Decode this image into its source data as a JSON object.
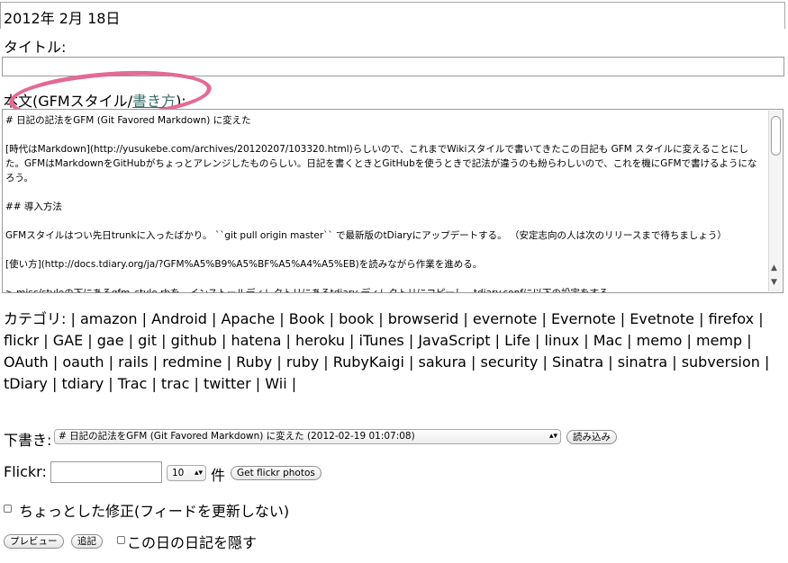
{
  "date": "2012年 2月 18日",
  "title_label": "タイトル:",
  "title_value": "",
  "body_label": {
    "prefix": "本文(GFMスタイル/",
    "link": "書き方",
    "suffix": "):"
  },
  "body_lines": [
    "# 日記の記法をGFM (Git Favored Markdown) に変えた",
    "[時代はMarkdown](http://yusukebe.com/archives/20120207/103320.html)らしいので、これまでWikiスタイルで書いてきたこの日記も GFM スタイルに変えることにした。GFMはMarkdownをGitHubがちょっとアレンジしたものらしい。日記を書くときとGitHubを使うときで記法が違うのも紛らわしいので、これを機にGFMで書けるようになろう。",
    "## 導入方法",
    "GFMスタイルはつい先日trunkに入ったばかり。 ``git pull origin master`` で最新版のtDiaryにアップデートする。 （安定志向の人は次のリリースまで待ちましょう）",
    "[使い方](http://docs.tdiary.org/ja/?GFM%A5%B9%A5%BF%A5%A4%A5%EB)を読みながら作業を進める。",
    "> misc/styleの下にあるgfm_style.rbを、インストールディレクトリにあるtdiary ディレクトリにコピーし、tdiary.confに以下の設定をする。"
  ],
  "categories": {
    "label": "カテゴリ:",
    "items": [
      "amazon",
      "Android",
      "Apache",
      "Book",
      "book",
      "browserid",
      "evernote",
      "Evernote",
      "Evetnote",
      "firefox",
      "flickr",
      "GAE",
      "gae",
      "git",
      "github",
      "hatena",
      "heroku",
      "iTunes",
      "JavaScript",
      "Life",
      "linux",
      "Mac",
      "memo",
      "memp",
      "OAuth",
      "oauth",
      "rails",
      "redmine",
      "Ruby",
      "ruby",
      "RubyKaigi",
      "sakura",
      "security",
      "Sinatra",
      "sinatra",
      "subversion",
      "tDiary",
      "tdiary",
      "Trac",
      "trac",
      "twitter",
      "Wii"
    ]
  },
  "draft": {
    "label": "下書き:",
    "selected": "# 日記の記法をGFM (Git Favored Markdown) に変えた (2012-02-19 01:07:08)",
    "load_button": "読み込み"
  },
  "flickr": {
    "label": "Flickr:",
    "count": "10",
    "unit": "件",
    "button": "Get flickr photos"
  },
  "minor_edit_label": "ちょっとした修正(フィードを更新しない)",
  "preview_button": "プレビュー",
  "append_button": "追記",
  "hide_label": "この日の日記を隠す",
  "colors": {
    "highlight": "#e36a96",
    "link": "#3a6e69"
  }
}
